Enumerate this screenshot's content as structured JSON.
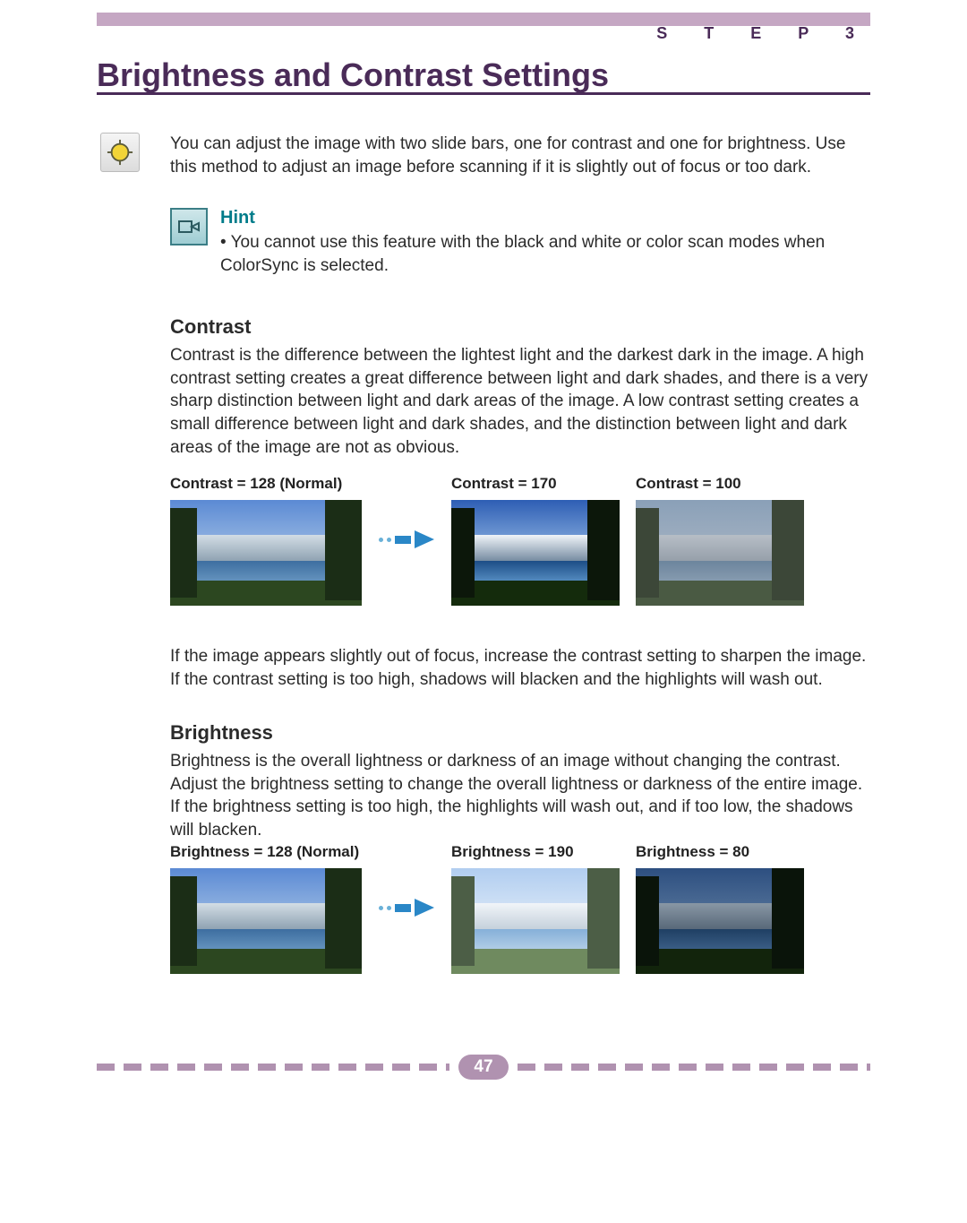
{
  "header": {
    "step_label": "S T E P   3",
    "title": "Brightness and Contrast Settings"
  },
  "intro": "You can adjust the image with two slide bars, one for contrast and one for brightness. Use this method to adjust an image before scanning if it is slightly out of focus or too dark.",
  "hint": {
    "title": "Hint",
    "body": "• You cannot use this feature with the black and white or color scan modes when ColorSync is selected."
  },
  "contrast": {
    "heading": "Contrast",
    "body": "Contrast is the difference between the lightest light and the darkest dark in the image. A high contrast setting creates a great difference between light and dark shades, and there is a very sharp distinction between light and dark areas of the image. A low contrast setting creates a small difference between light and dark shades, and the distinction between light and dark areas of the image are not as obvious.",
    "captions": {
      "normal": "Contrast = 128 (Normal)",
      "high": "Contrast = 170",
      "low": "Contrast = 100"
    },
    "note": "If the image appears slightly out of focus, increase the contrast setting to sharpen the image. If the contrast setting is too high, shadows will blacken and the highlights will wash out."
  },
  "brightness": {
    "heading": "Brightness",
    "body": "Brightness is the overall lightness or darkness of an image without changing the contrast. Adjust the brightness setting to change the overall lightness or darkness of the entire image. If the brightness setting is too high, the highlights will wash out, and if too low, the shadows will blacken.",
    "captions": {
      "normal": "Brightness = 128 (Normal)",
      "high": "Brightness = 190",
      "low": "Brightness = 80"
    }
  },
  "page_number": "47"
}
